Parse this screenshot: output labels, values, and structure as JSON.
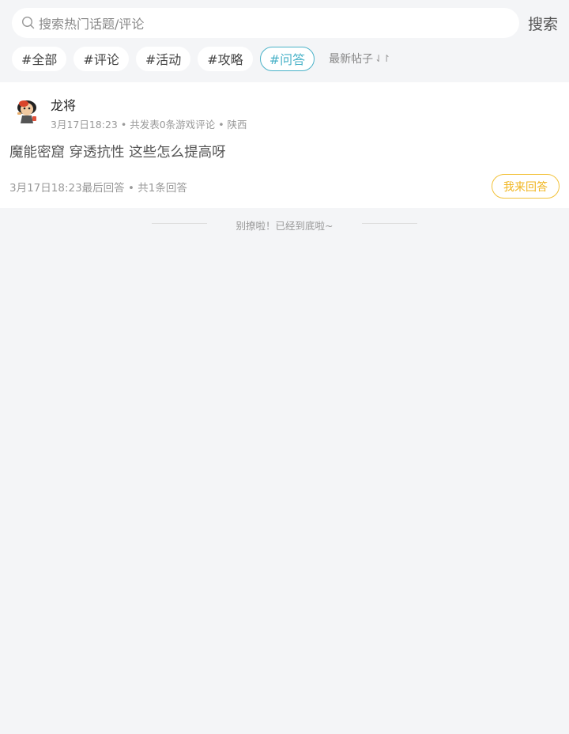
{
  "search": {
    "placeholder": "搜索热门话题/评论",
    "button_label": "搜索"
  },
  "tags": [
    {
      "label": "#全部",
      "active": false
    },
    {
      "label": "#评论",
      "active": false
    },
    {
      "label": "#活动",
      "active": false
    },
    {
      "label": "#攻略",
      "active": false
    },
    {
      "label": "#问答",
      "active": true
    }
  ],
  "sort": {
    "label": "最新帖子",
    "icon": "sort-arrows-icon"
  },
  "post": {
    "author": "龙将",
    "time": "3月17日18:23",
    "stats": "共发表0条游戏评论",
    "region": "陕西",
    "title": "魔能密窟 穿透抗性 这些怎么提高呀",
    "last_reply": "3月17日18:23最后回答",
    "reply_count": "共1条回答",
    "answer_button": "我来回答"
  },
  "end_message": "别撩啦！已经到底啦~",
  "colors": {
    "accent": "#4ab2c8",
    "answer": "#f0b51e",
    "background": "#f4f5f7"
  }
}
